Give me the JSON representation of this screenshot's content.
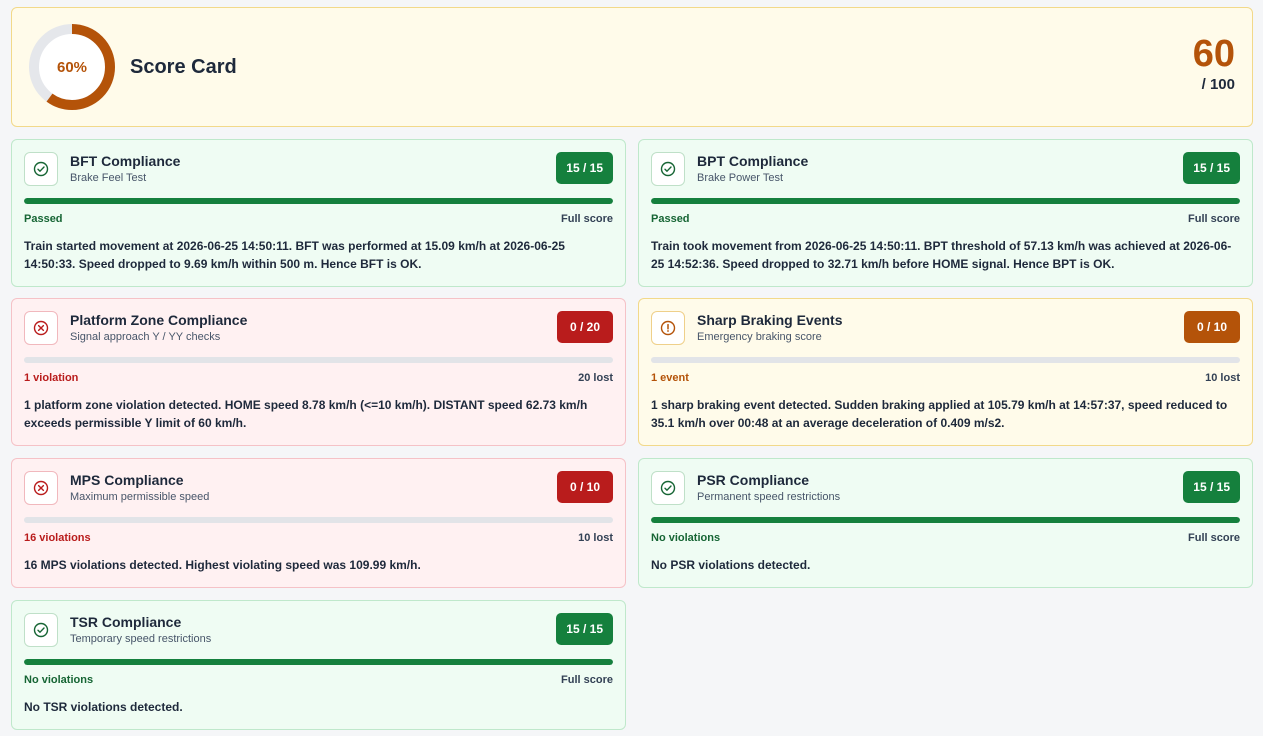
{
  "header": {
    "percent_label": "60%",
    "percent_value": 60,
    "title": "Score Card",
    "score": "60",
    "score_total": "/ 100"
  },
  "colors": {
    "ok": "#15803d",
    "bad": "#b91c1c",
    "warn": "#b45309",
    "ring_track": "#e5e7eb"
  },
  "cards": [
    {
      "title": "BFT Compliance",
      "subtitle": "Brake Feel Test",
      "badge": "15 / 15",
      "progress_fraction": 1.0,
      "status": "Passed",
      "status_right": "Full score",
      "description": "Train started movement at 2026-06-25 14:50:11. BFT was performed at 15.09 km/h at 2026-06-25 14:50:33. Speed dropped to 9.69 km/h within 500 m. Hence BFT is OK.",
      "icon": "check-circle-icon"
    },
    {
      "title": "BPT Compliance",
      "subtitle": "Brake Power Test",
      "badge": "15 / 15",
      "progress_fraction": 1.0,
      "status": "Passed",
      "status_right": "Full score",
      "description": "Train took movement from 2026-06-25 14:50:11. BPT threshold of 57.13 km/h was achieved at 2026-06-25 14:52:36. Speed dropped to 32.71 km/h before HOME signal. Hence BPT is OK.",
      "icon": "check-circle-icon"
    },
    {
      "title": "Platform Zone Compliance",
      "subtitle": "Signal approach Y / YY checks",
      "badge": "0 / 20",
      "progress_fraction": 0.0,
      "status": "1 violation",
      "status_right": "20 lost",
      "description": "1 platform zone violation detected. HOME speed 8.78 km/h (<=10 km/h). DISTANT speed 62.73 km/h exceeds permissible Y limit of 60 km/h.",
      "icon": "x-circle-icon"
    },
    {
      "title": "Sharp Braking Events",
      "subtitle": "Emergency braking score",
      "badge": "0 / 10",
      "progress_fraction": 0.0,
      "status": "1 event",
      "status_right": "10 lost",
      "description": "1 sharp braking event detected. Sudden braking applied at 105.79 km/h at 14:57:37, speed reduced to 35.1 km/h over 00:48 at an average deceleration of 0.409 m/s2.",
      "icon": "exclamation-circle-icon"
    },
    {
      "title": "MPS Compliance",
      "subtitle": "Maximum permissible speed",
      "badge": "0 / 10",
      "progress_fraction": 0.0,
      "status": "16 violations",
      "status_right": "10 lost",
      "description": "16 MPS violations detected. Highest violating speed was 109.99 km/h.",
      "icon": "x-circle-icon"
    },
    {
      "title": "PSR Compliance",
      "subtitle": "Permanent speed restrictions",
      "badge": "15 / 15",
      "progress_fraction": 1.0,
      "status": "No violations",
      "status_right": "Full score",
      "description": "No PSR violations detected.",
      "icon": "check-circle-icon"
    },
    {
      "title": "TSR Compliance",
      "subtitle": "Temporary speed restrictions",
      "badge": "15 / 15",
      "progress_fraction": 1.0,
      "status": "No violations",
      "status_right": "Full score",
      "description": "No TSR violations detected.",
      "icon": "check-circle-icon"
    }
  ]
}
